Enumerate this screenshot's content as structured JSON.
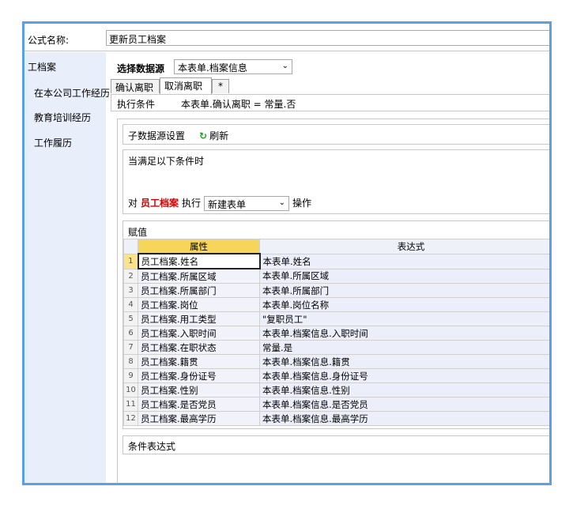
{
  "formula": {
    "label": "公式名称:",
    "value": "更新员工档案"
  },
  "nav": {
    "root": "工档案",
    "items": [
      "在本公司工作经历",
      "教育培训经历",
      "工作履历"
    ]
  },
  "datasource": {
    "label": "选择数据源",
    "value": "本表单.档案信息"
  },
  "tabs": [
    {
      "label": "确认离职",
      "active": false
    },
    {
      "label": "取消离职",
      "active": true
    },
    {
      "label": "*",
      "active": false
    }
  ],
  "condition": {
    "label": "执行条件",
    "value": "本表单.确认离职 = 常量.否"
  },
  "subsource": {
    "title": "子数据源设置",
    "refresh_label": "刷新"
  },
  "when": {
    "title": "当满足以下条件时"
  },
  "action": {
    "prefix": "对",
    "target": "员工档案",
    "exec": "执行",
    "mode": "新建表单",
    "suffix": "操作"
  },
  "assign": {
    "title": "赋值",
    "headers": {
      "property": "属性",
      "expression": "表达式"
    },
    "rows": [
      {
        "num": "1",
        "property": "员工档案.姓名",
        "expression": "本表单.姓名"
      },
      {
        "num": "2",
        "property": "员工档案.所属区域",
        "expression": "本表单.所属区域"
      },
      {
        "num": "3",
        "property": "员工档案.所属部门",
        "expression": "本表单.所属部门"
      },
      {
        "num": "4",
        "property": "员工档案.岗位",
        "expression": "本表单.岗位名称"
      },
      {
        "num": "5",
        "property": "员工档案.用工类型",
        "expression": "\"复职员工\""
      },
      {
        "num": "6",
        "property": "员工档案.入职时间",
        "expression": "本表单.档案信息.入职时间"
      },
      {
        "num": "7",
        "property": "员工档案.在职状态",
        "expression": "常量.是"
      },
      {
        "num": "8",
        "property": "员工档案.籍贯",
        "expression": "本表单.档案信息.籍贯"
      },
      {
        "num": "9",
        "property": "员工档案.身份证号",
        "expression": "本表单.档案信息.身份证号"
      },
      {
        "num": "10",
        "property": "员工档案.性别",
        "expression": "本表单.档案信息.性别"
      },
      {
        "num": "11",
        "property": "员工档案.是否党员",
        "expression": "本表单.档案信息.是否党员"
      },
      {
        "num": "12",
        "property": "员工档案.最高学历",
        "expression": "本表单.档案信息.最高学历"
      }
    ]
  },
  "expr_bar": {
    "title": "条件表达式"
  }
}
